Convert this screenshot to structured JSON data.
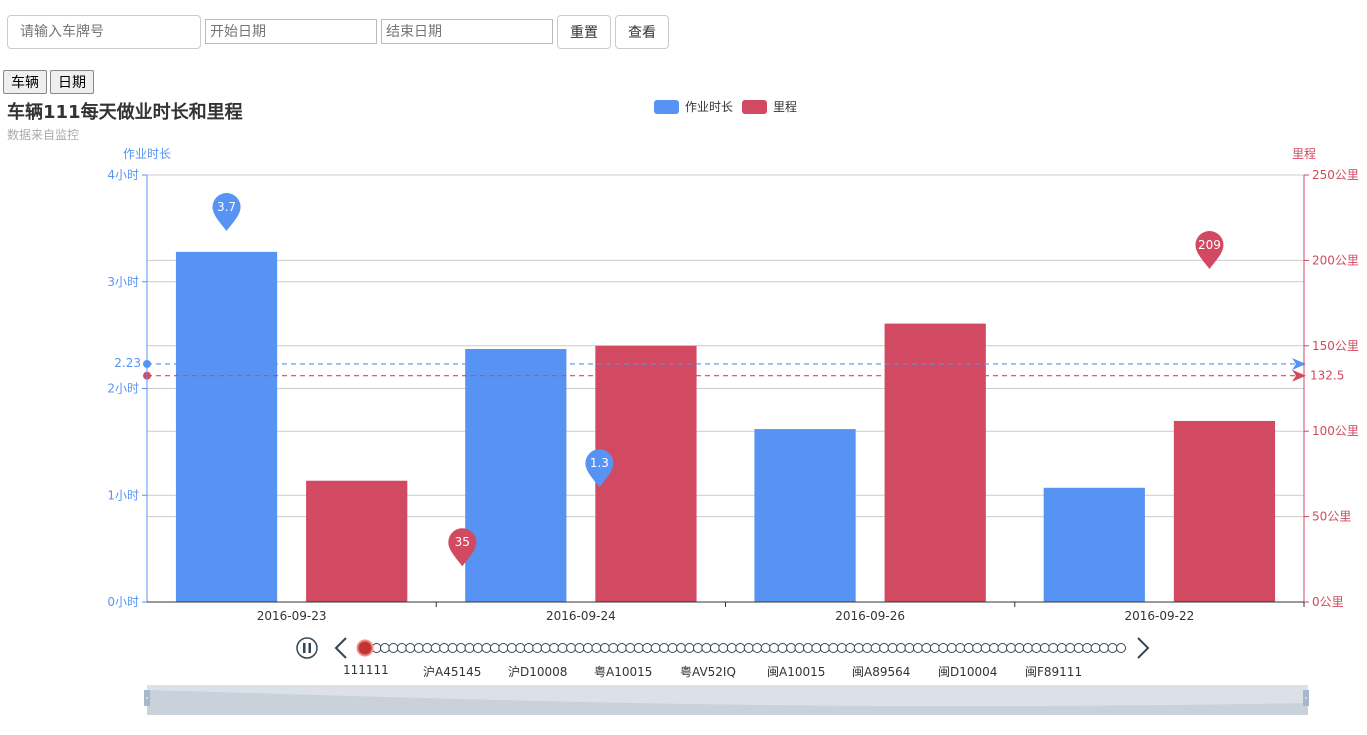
{
  "filters": {
    "plate_placeholder": "请输入车牌号",
    "start_placeholder": "开始日期",
    "end_placeholder": "结束日期",
    "reset_label": "重置",
    "view_label": "查看"
  },
  "switch": {
    "vehicle_label": "车辆",
    "date_label": "日期"
  },
  "colors": {
    "duration": "#5793f3",
    "mileage": "#d14a61",
    "grid": "#cccccc",
    "timeline_active": "#c23531",
    "slider_fill": "#d3dae3"
  },
  "chart_data": {
    "type": "bar",
    "title": "车辆111每天做业时长和里程",
    "subtitle": "数据来自监控",
    "categories": [
      "2016-09-23",
      "2016-09-24",
      "2016-09-26",
      "2016-09-22"
    ],
    "legend": [
      "作业时长",
      "里程"
    ],
    "legend_position": "top-center",
    "series": [
      {
        "name": "作业时长",
        "axis": "left",
        "values": [
          3.28,
          2.37,
          1.62,
          1.07
        ],
        "markPoint": {
          "label": "3.7",
          "category": "2016-09-23",
          "value": 3.7
        },
        "markPointMin": {
          "label": "1.3",
          "category": "2016-09-24",
          "value": 1.3
        },
        "markLine": {
          "label": "2.23",
          "value": 2.23
        }
      },
      {
        "name": "里程",
        "axis": "right",
        "values": [
          71,
          150,
          163,
          106
        ],
        "markPoint": {
          "label": "209",
          "category": "2016-09-22",
          "value": 209
        },
        "markPointMin": {
          "label": "35",
          "category": "2016-09-23",
          "value": 35
        },
        "markLine": {
          "label": "132.5",
          "value": 132.5
        }
      }
    ],
    "y_left": {
      "name": "作业时长",
      "min": 0,
      "max": 4,
      "ticks": [
        0,
        1,
        2,
        3,
        4
      ],
      "unit": "小时"
    },
    "y_right": {
      "name": "里程",
      "min": 0,
      "max": 250,
      "ticks": [
        0,
        50,
        100,
        150,
        200,
        250
      ],
      "unit": "公里"
    },
    "grid": true
  },
  "timeline": {
    "labels": [
      "111111",
      "沪A45145",
      "沪D10008",
      "粤A10015",
      "粤AV52IQ",
      "闽A10015",
      "闽A89564",
      "闽D10004",
      "闽F89111"
    ],
    "current_index": 0,
    "dot_count": 90
  }
}
